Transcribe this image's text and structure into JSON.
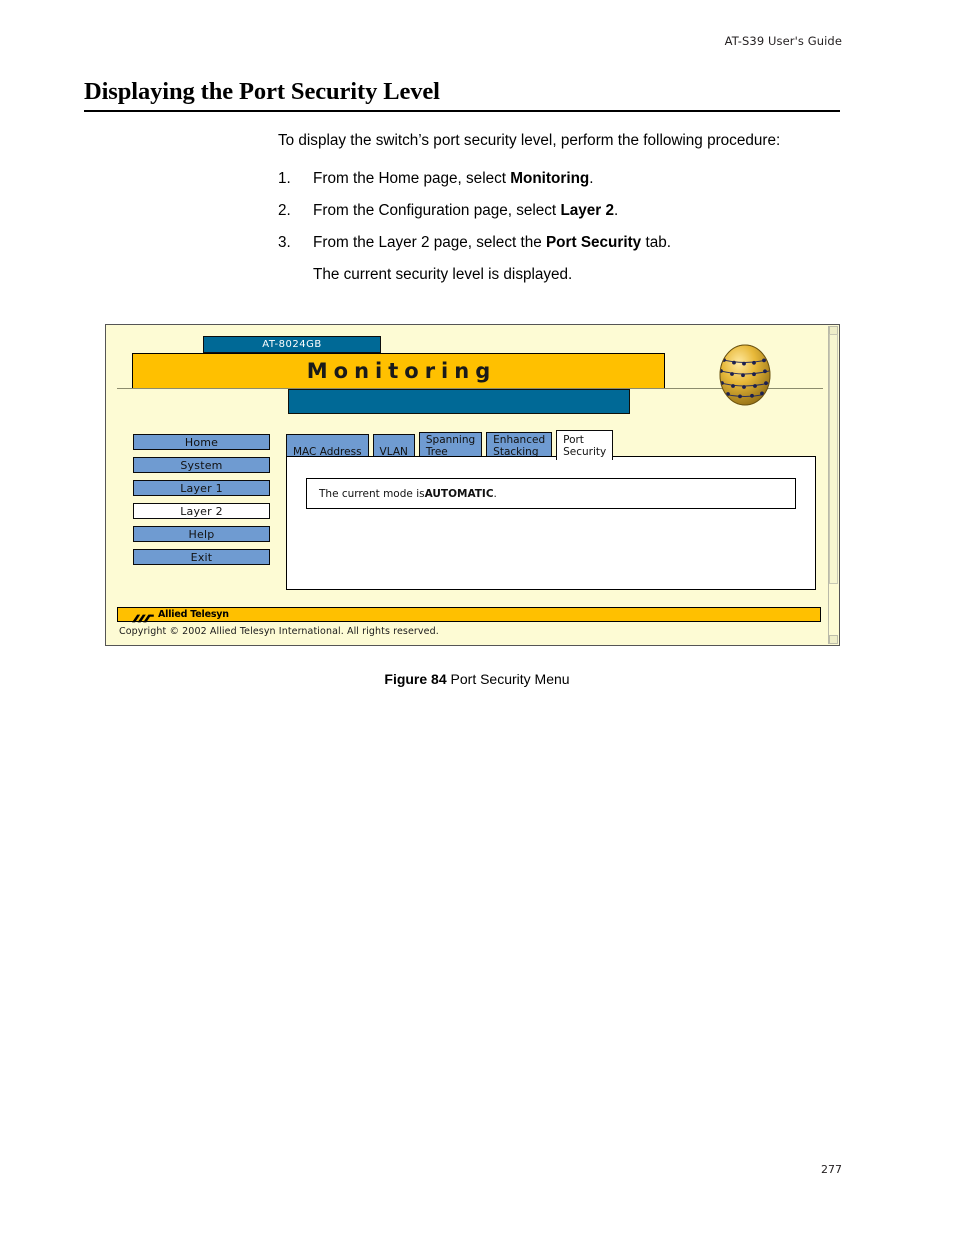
{
  "header": {
    "running_head": "AT-S39 User's Guide"
  },
  "page": {
    "title": "Displaying the Port Security Level",
    "folio": "277"
  },
  "body": {
    "intro": "To display the switch’s port security level, perform the following procedure:",
    "steps": [
      {
        "num": "1.",
        "pre": "From the Home page, select ",
        "bold": "Monitoring",
        "post": "."
      },
      {
        "num": "2.",
        "pre": "From the Configuration page, select ",
        "bold": "Layer 2",
        "post": "."
      },
      {
        "num": "3.",
        "pre": "From the Layer 2 page, select the ",
        "bold": "Port Security",
        "post": " tab."
      }
    ],
    "after_steps": "The current security level is displayed."
  },
  "figure": {
    "caption_number": "Figure 84",
    "caption_text": "Port Security Menu",
    "screenshot": {
      "device_label": "AT-8024GB",
      "banner_title": "Monitoring",
      "globe_icon": "network-globe-icon",
      "sidebar": {
        "items": [
          {
            "label": "Home",
            "selected": false
          },
          {
            "label": "System",
            "selected": false
          },
          {
            "label": "Layer 1",
            "selected": false
          },
          {
            "label": "Layer 2",
            "selected": true
          },
          {
            "label": "Help",
            "selected": false
          },
          {
            "label": "Exit",
            "selected": false
          }
        ]
      },
      "tabs": [
        {
          "line1": "MAC Address",
          "line2": "",
          "active": false
        },
        {
          "line1": "VLAN",
          "line2": "",
          "active": false
        },
        {
          "line1": "Spanning",
          "line2": "Tree",
          "active": false
        },
        {
          "line1": "Enhanced",
          "line2": "Stacking",
          "active": false
        },
        {
          "line1": "Port",
          "line2": "Security",
          "active": true
        }
      ],
      "content": {
        "mode_pre": "The current mode is ",
        "mode_value": "AUTOMATIC",
        "mode_post": "."
      },
      "footer": {
        "brand": "Allied Telesyn",
        "copyright": "Copyright © 2002 Allied Telesyn International. All rights reserved."
      }
    }
  },
  "colors": {
    "banner_yellow": "#ffc000",
    "panel_cream": "#fdfbd4",
    "deep_blue": "#006996",
    "tab_blue": "#6f9bd1"
  }
}
